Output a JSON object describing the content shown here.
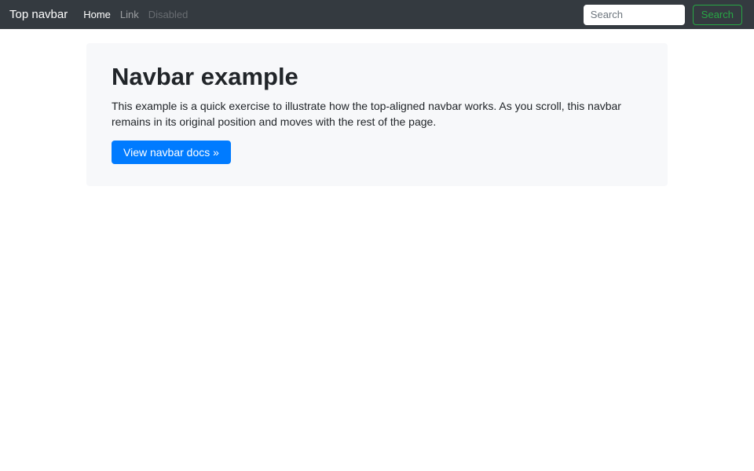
{
  "navbar": {
    "brand": "Top navbar",
    "links": [
      {
        "label": "Home",
        "state": "active"
      },
      {
        "label": "Link",
        "state": "normal"
      },
      {
        "label": "Disabled",
        "state": "disabled"
      }
    ],
    "search": {
      "placeholder": "Search",
      "button_label": "Search"
    }
  },
  "jumbotron": {
    "title": "Navbar example",
    "description": "This example is a quick exercise to illustrate how the top-aligned navbar works. As you scroll, this navbar remains in its original position and moves with the rest of the page.",
    "cta_label": "View navbar docs »"
  },
  "colors": {
    "navbar_bg": "#343a40",
    "navbar_text": "#ffffff",
    "success_green": "#28a745",
    "primary_blue": "#007bff",
    "jumbotron_bg": "#f7f8fa",
    "body_text": "#212529"
  }
}
